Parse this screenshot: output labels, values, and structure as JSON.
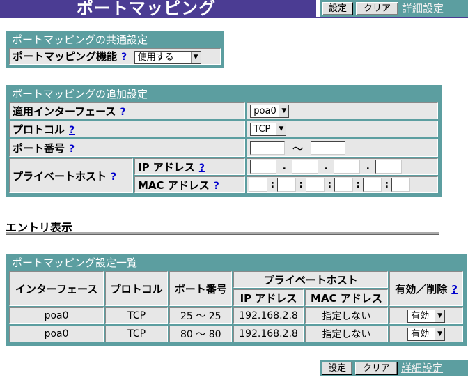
{
  "header": {
    "title": "ポートマッピング",
    "buttons": {
      "set": "設定",
      "clear": "クリア",
      "advanced": "詳細設定"
    }
  },
  "common": {
    "title": "ポートマッピングの共通設定",
    "feature_label": "ポートマッピング機能",
    "help": "?",
    "feature_value": "使用する"
  },
  "add": {
    "title": "ポートマッピングの追加設定",
    "help": "?",
    "interface_label": "適用インターフェース",
    "interface_value": "poa0",
    "protocol_label": "プロトコル",
    "protocol_value": "TCP",
    "port_label": "ポート番号",
    "port_sep": "〜",
    "private_host_label": "プライベートホスト",
    "ip_label": "IP アドレス",
    "mac_label": "MAC アドレス",
    "ip_sep": ".",
    "mac_sep": ":"
  },
  "entry_heading": "エントリ表示",
  "list": {
    "title": "ポートマッピング設定一覧",
    "headers": {
      "interface": "インターフェース",
      "protocol": "プロトコル",
      "port": "ポート番号",
      "private_host": "プライベートホスト",
      "ip": "IP アドレス",
      "mac": "MAC アドレス",
      "enable_delete": "有効／削除",
      "help": "?"
    },
    "rows": [
      {
        "interface": "poa0",
        "protocol": "TCP",
        "port": "25 〜 25",
        "ip": "192.168.2.8",
        "mac": "指定しない",
        "status": "有効"
      },
      {
        "interface": "poa0",
        "protocol": "TCP",
        "port": "80 〜 80",
        "ip": "192.168.2.8",
        "mac": "指定しない",
        "status": "有効"
      }
    ]
  },
  "colors": {
    "title_bg": "#4b3c93",
    "panel_bg": "#5c9ea0",
    "cell_bg": "#e7e7e7",
    "link": "#0000cc"
  }
}
